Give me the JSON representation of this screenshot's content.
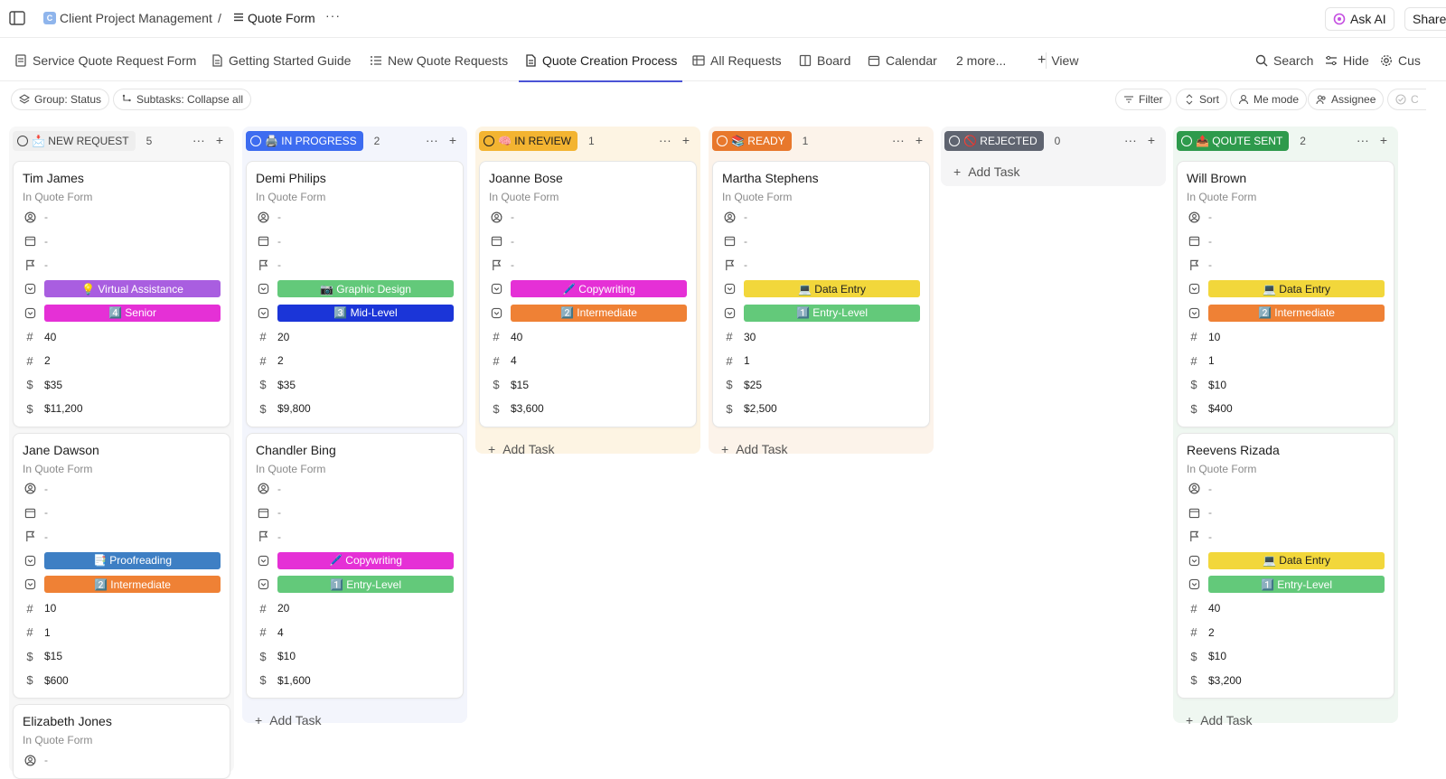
{
  "breadcrumb": {
    "space_initial": "C",
    "space": "Client Project Management",
    "separator": "/",
    "list": "Quote Form",
    "more": "···"
  },
  "header": {
    "ask_ai": "Ask AI",
    "share": "Share"
  },
  "tabs": [
    {
      "label": "Service Quote Request Form",
      "icon": "form-icon"
    },
    {
      "label": "Getting Started Guide",
      "icon": "doc-icon"
    },
    {
      "label": "New Quote Requests",
      "icon": "list-icon"
    },
    {
      "label": "Quote Creation Process",
      "icon": "doc-icon",
      "active": true
    },
    {
      "label": "All Requests",
      "icon": "table-icon"
    },
    {
      "label": "Board",
      "icon": "board-icon"
    },
    {
      "label": "Calendar",
      "icon": "calendar-icon"
    },
    {
      "label": "2 more...",
      "icon": ""
    },
    {
      "label": "View",
      "icon": "plus-icon"
    }
  ],
  "tab_tools": {
    "search": "Search",
    "hide": "Hide",
    "customize": "Cus"
  },
  "filters": {
    "group": "Group: Status",
    "subtasks": "Subtasks: Collapse all",
    "filter": "Filter",
    "sort": "Sort",
    "me_mode": "Me mode",
    "assignee": "Assignee",
    "closed": "C"
  },
  "colors": {
    "accent": "#4b53d6",
    "virtual_assistance": "#a95ee0",
    "senior": "#e530d6",
    "graphic_design": "#63c97a",
    "mid_level": "#1b35d8",
    "copywriting": "#e530d6",
    "intermediate": "#ef8135",
    "data_entry": "#f2d73b",
    "entry_level": "#63c97a",
    "proofreading": "#3e7fc4"
  },
  "board": {
    "add_task": "Add Task",
    "empty_dash": "-",
    "list_label": "In Quote Form",
    "columns": [
      {
        "status": "📩 NEW REQUEST",
        "count": "5",
        "pill_color": "#eeeeee",
        "pill_text": "#444444",
        "bg": "#f7f7f7",
        "cards": [
          {
            "title": "Tim James",
            "service": "💡 Virtual Assistance",
            "service_color": "#a95ee0",
            "level": "4️⃣ Senior",
            "level_color": "#e530d6",
            "n1": "40",
            "n2": "2",
            "rate": "$35",
            "total": "$11,200"
          },
          {
            "title": "Jane Dawson",
            "service": "📑 Proofreading",
            "service_color": "#3e7fc4",
            "level": "2️⃣ Intermediate",
            "level_color": "#ef8135",
            "n1": "10",
            "n2": "1",
            "rate": "$15",
            "total": "$600"
          },
          {
            "title": "Elizabeth Jones",
            "partial": true
          }
        ]
      },
      {
        "status": "🖨️ IN PROGRESS",
        "count": "2",
        "pill_color": "#3d6cf0",
        "pill_text": "#ffffff",
        "bg": "#f3f5fc",
        "cards": [
          {
            "title": "Demi Philips",
            "service": "📷 Graphic Design",
            "service_color": "#63c97a",
            "level": "3️⃣ Mid-Level",
            "level_color": "#1b35d8",
            "n1": "20",
            "n2": "2",
            "rate": "$35",
            "total": "$9,800"
          },
          {
            "title": "Chandler Bing",
            "service": "🖊️ Copywriting",
            "service_color": "#e530d6",
            "level": "1️⃣ Entry-Level",
            "level_color": "#63c97a",
            "n1": "20",
            "n2": "4",
            "rate": "$10",
            "total": "$1,600"
          }
        ]
      },
      {
        "status": "🧠 IN REVIEW",
        "count": "1",
        "pill_color": "#f3b431",
        "pill_text": "#202020",
        "bg": "#fdf4e3",
        "cards": [
          {
            "title": "Joanne Bose",
            "service": "🖊️ Copywriting",
            "service_color": "#e530d6",
            "level": "2️⃣ Intermediate",
            "level_color": "#ef8135",
            "n1": "40",
            "n2": "4",
            "rate": "$15",
            "total": "$3,600"
          }
        ]
      },
      {
        "status": "📚 READY",
        "count": "1",
        "pill_color": "#e8782c",
        "pill_text": "#ffffff",
        "bg": "#fcf3ea",
        "cards": [
          {
            "title": "Martha Stephens",
            "service": "💻 Data Entry",
            "service_color": "#f2d73b",
            "level": "1️⃣ Entry-Level",
            "level_color": "#63c97a",
            "n1": "30",
            "n2": "1",
            "rate": "$25",
            "total": "$2,500"
          }
        ]
      },
      {
        "status": "🚫 REJECTED",
        "count": "0",
        "pill_color": "#5f6470",
        "pill_text": "#ffffff",
        "bg": "#f5f5f6",
        "cards": []
      },
      {
        "status": "📤 QOUTE SENT",
        "count": "2",
        "pill_color": "#2e9a4c",
        "pill_text": "#ffffff",
        "bg": "#eff7f1",
        "cards": [
          {
            "title": "Will Brown",
            "service": "💻 Data Entry",
            "service_color": "#f2d73b",
            "level": "2️⃣ Intermediate",
            "level_color": "#ef8135",
            "n1": "10",
            "n2": "1",
            "rate": "$10",
            "total": "$400"
          },
          {
            "title": "Reevens Rizada",
            "service": "💻 Data Entry",
            "service_color": "#f2d73b",
            "level": "1️⃣ Entry-Level",
            "level_color": "#63c97a",
            "n1": "40",
            "n2": "2",
            "rate": "$10",
            "total": "$3,200"
          }
        ]
      }
    ]
  }
}
